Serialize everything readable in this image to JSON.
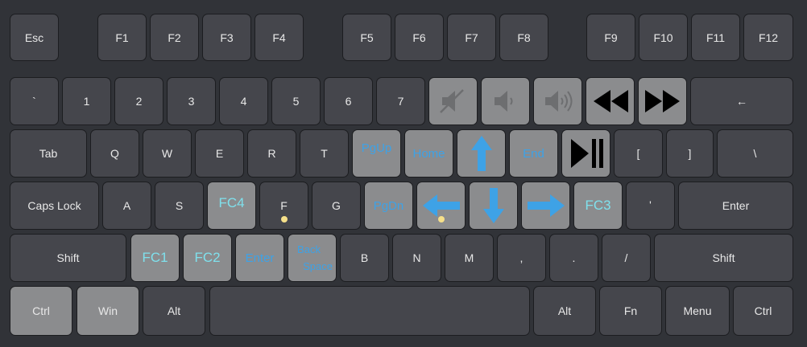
{
  "function_row": {
    "esc": "Esc",
    "f1": "F1",
    "f2": "F2",
    "f3": "F3",
    "f4": "F4",
    "f5": "F5",
    "f6": "F6",
    "f7": "F7",
    "f8": "F8",
    "f9": "F9",
    "f10": "F10",
    "f11": "F11",
    "f12": "F12"
  },
  "number_row": {
    "backtick": "`",
    "n1": "1",
    "n2": "2",
    "n3": "3",
    "n4": "4",
    "n5": "5",
    "n6": "6",
    "n7": "7",
    "mute_icon": "speaker-mute-icon",
    "vol_down_icon": "volume-down-icon",
    "vol_up_icon": "volume-up-icon",
    "prev_icon": "rewind-icon",
    "next_icon": "fast-forward-icon",
    "backspace": "←"
  },
  "tab_row": {
    "tab": "Tab",
    "q": "Q",
    "w": "W",
    "e": "E",
    "r": "R",
    "t": "T",
    "pgup": "PgUp",
    "home": "Home",
    "up_icon": "arrow-up-icon",
    "end": "End",
    "play_pause_icon": "play-pause-icon",
    "lbracket": "[",
    "rbracket": "]",
    "backslash": "\\"
  },
  "caps_row": {
    "caps": "Caps Lock",
    "a": "A",
    "s": "S",
    "fc4": "FC4",
    "f": "F",
    "g": "G",
    "pgdn": "PgDn",
    "left_icon": "arrow-left-icon",
    "down_icon": "arrow-down-icon",
    "right_icon": "arrow-right-icon",
    "fc3": "FC3",
    "quote": "'",
    "enter": "Enter"
  },
  "shift_row": {
    "shift_left": "Shift",
    "fc1": "FC1",
    "fc2": "FC2",
    "enter_alt": "Enter",
    "back_space_1": "Back",
    "back_space_2": "Space",
    "b": "B",
    "n": "N",
    "m": "M",
    "comma": ",",
    "period": ".",
    "slash": "/",
    "shift_right": "Shift"
  },
  "bottom_row": {
    "ctrl_left": "Ctrl",
    "win": "Win",
    "alt_left": "Alt",
    "space": "",
    "alt_right": "Alt",
    "fn": "Fn",
    "menu": "Menu",
    "ctrl_right": "Ctrl"
  },
  "colors": {
    "background": "#313338",
    "key_dark": "#45464c",
    "key_highlight": "#8b8c8e",
    "remap_blue": "#3ea2e6",
    "remap_cyan": "#7fe0ec",
    "dot_yellow": "#f6e08a"
  }
}
